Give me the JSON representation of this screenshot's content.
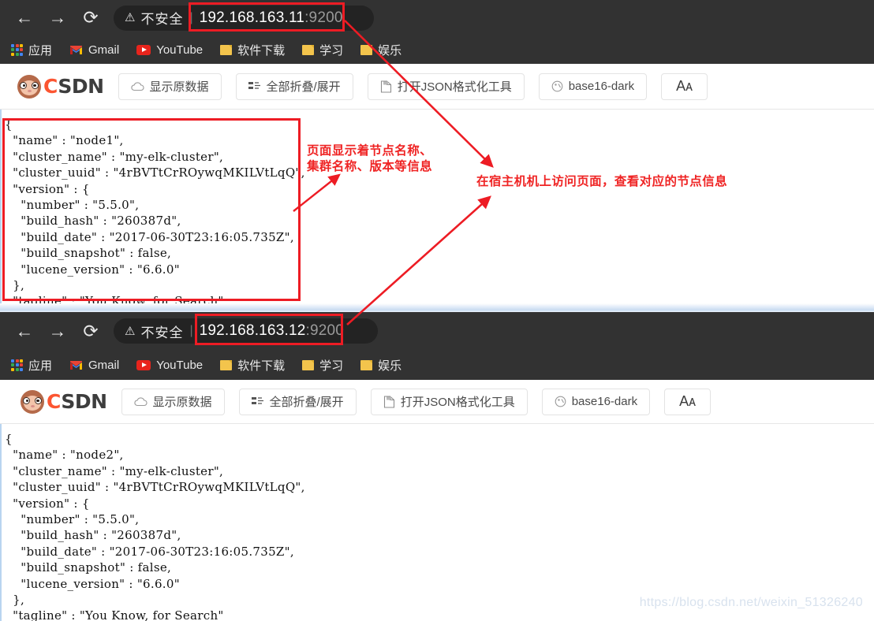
{
  "windows": [
    {
      "id": "win-top",
      "omnibox": {
        "security_label": "不安全",
        "warning_icon": "warning-triangle-icon",
        "url_host": "192.168.163.11",
        "url_port": ":9200"
      },
      "nav": {
        "back_icon": "arrow-left-icon",
        "forward_icon": "arrow-right-icon",
        "reload_icon": "reload-icon"
      },
      "bookmarks": [
        {
          "icon": "apps-grid-icon",
          "label": "应用"
        },
        {
          "icon": "gmail-icon",
          "label": "Gmail"
        },
        {
          "icon": "youtube-icon",
          "label": "YouTube"
        },
        {
          "icon": "folder-icon",
          "label": "软件下载"
        },
        {
          "icon": "folder-icon",
          "label": "学习"
        },
        {
          "icon": "folder-icon",
          "label": "娱乐"
        }
      ],
      "toolbar": {
        "logo_text_c": "C",
        "logo_text_sdn": "SDN",
        "buttons": [
          {
            "icon": "cloud-icon",
            "label": "显示原数据"
          },
          {
            "icon": "collapse-expand-icon",
            "label": "全部折叠/展开"
          },
          {
            "icon": "json-file-icon",
            "label": "打开JSON格式化工具"
          },
          {
            "icon": "palette-icon",
            "label": "base16-dark"
          },
          {
            "icon": "font-size-icon",
            "label": "Aᴀ"
          }
        ]
      },
      "json_text": "{\n  \"name\" : \"node1\",\n  \"cluster_name\" : \"my-elk-cluster\",\n  \"cluster_uuid\" : \"4rBVTtCrROywqMKILVtLqQ\",\n  \"version\" : {\n    \"number\" : \"5.5.0\",\n    \"build_hash\" : \"260387d\",\n    \"build_date\" : \"2017-06-30T23:16:05.735Z\",\n    \"build_snapshot\" : false,\n    \"lucene_version\" : \"6.6.0\"\n  },\n  \"tagline\" : \"You Know, for Search\"\n}"
    },
    {
      "id": "win-bottom",
      "omnibox": {
        "security_label": "不安全",
        "warning_icon": "warning-triangle-icon",
        "url_host": "192.168.163.12",
        "url_port": ":9200"
      },
      "nav": {
        "back_icon": "arrow-left-icon",
        "forward_icon": "arrow-right-icon",
        "reload_icon": "reload-icon"
      },
      "bookmarks": [
        {
          "icon": "apps-grid-icon",
          "label": "应用"
        },
        {
          "icon": "gmail-icon",
          "label": "Gmail"
        },
        {
          "icon": "youtube-icon",
          "label": "YouTube"
        },
        {
          "icon": "folder-icon",
          "label": "软件下载"
        },
        {
          "icon": "folder-icon",
          "label": "学习"
        },
        {
          "icon": "folder-icon",
          "label": "娱乐"
        }
      ],
      "toolbar": {
        "logo_text_c": "C",
        "logo_text_sdn": "SDN",
        "buttons": [
          {
            "icon": "cloud-icon",
            "label": "显示原数据"
          },
          {
            "icon": "collapse-expand-icon",
            "label": "全部折叠/展开"
          },
          {
            "icon": "json-file-icon",
            "label": "打开JSON格式化工具"
          },
          {
            "icon": "palette-icon",
            "label": "base16-dark"
          },
          {
            "icon": "font-size-icon",
            "label": "Aᴀ"
          }
        ]
      },
      "json_text": "{\n  \"name\" : \"node2\",\n  \"cluster_name\" : \"my-elk-cluster\",\n  \"cluster_uuid\" : \"4rBVTtCrROywqMKILVtLqQ\",\n  \"version\" : {\n    \"number\" : \"5.5.0\",\n    \"build_hash\" : \"260387d\",\n    \"build_date\" : \"2017-06-30T23:16:05.735Z\",\n    \"build_snapshot\" : false,\n    \"lucene_version\" : \"6.6.0\"\n  },\n  \"tagline\" : \"You Know, for Search\"\n}"
    }
  ],
  "annotations": [
    {
      "id": "anno-page-info",
      "text": "页面显示着节点名称、\n集群名称、版本等信息"
    },
    {
      "id": "anno-host-visit",
      "text": "在宿主机机上访问页面，查看对应的节点信息"
    }
  ],
  "watermark": "https://blog.csdn.net/weixin_51326240",
  "colors": {
    "annotation_red": "#ef2424",
    "box_red": "#ed1c24",
    "chrome_bg": "#323232",
    "omnibox_bg": "#232323",
    "csdn_orange": "#fc5531"
  }
}
